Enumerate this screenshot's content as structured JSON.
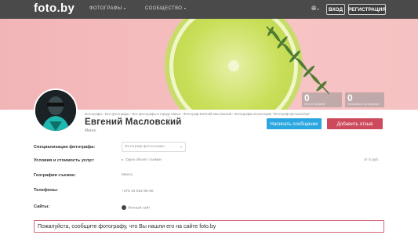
{
  "header": {
    "logo": "foto.by",
    "nav": [
      {
        "label": "ФОТОГРАФЫ"
      },
      {
        "label": "СООБЩЕСТВО"
      }
    ],
    "login": "ВХОД",
    "register": "РЕГИСТРАЦИЯ"
  },
  "stats": [
    {
      "value": "0",
      "label": "Фото в профиле"
    },
    {
      "value": "0",
      "label": "Просмотров на странице"
    }
  ],
  "profile": {
    "breadcrumb": "Фотографы › Все фотографы › Все фотографы в городе Минск › Фотограф Евгений Масловский › Фотографии в категории \"Фотограф фотоальбом\"",
    "name": "Евгений Масловский",
    "city": "Минск",
    "message_button": "Написать сообщение",
    "review_button": "Добавить отзыв"
  },
  "details": {
    "specialization_label": "Специализации фотографа:",
    "specialization_value": "Фотограф фотосъемки",
    "conditions_label": "Условия и стоимость услуг:",
    "conditions_value": "Одна объект съемки",
    "price": "от 5 руб.",
    "geography_label": "География съемок:",
    "geography_value": "Минск",
    "phones_label": "Телефоны:",
    "phones_value": "+375 44 592-95-68",
    "sites_label": "Сайты:",
    "sites_value": "Личный сайт"
  },
  "notice": "Пожалуйста, сообщите фотографу, что Вы нашли его на сайте foto.by",
  "colors": {
    "header_bg": "#4a4a4a",
    "message_button": "#2aa6e0",
    "review_button": "#cc4a5c",
    "notice_border": "#d36a7a"
  }
}
